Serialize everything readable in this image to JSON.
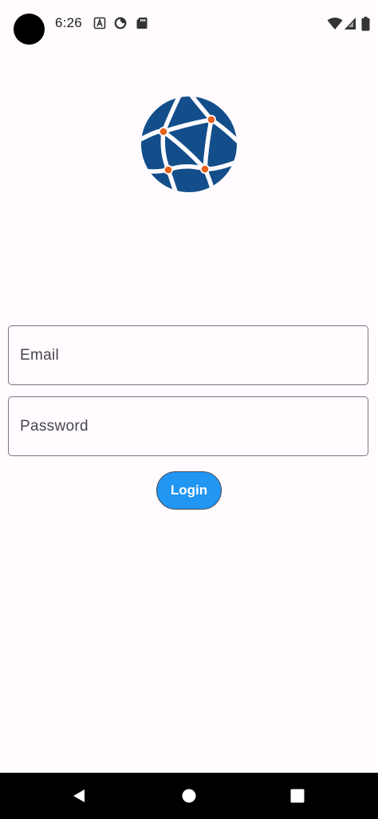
{
  "status_bar": {
    "time": "6:26",
    "left_icons": [
      "a-box-icon",
      "data-saver-icon",
      "sd-card-icon"
    ],
    "right_icons": [
      "wifi-icon",
      "cellular-signal-icon",
      "battery-icon"
    ]
  },
  "app": {
    "logo": "globe-network-logo",
    "colors": {
      "logo_blue": "#134e8a",
      "node_orange": "#e8631c",
      "button": "#2196f3"
    }
  },
  "form": {
    "email_placeholder": "Email",
    "password_placeholder": "Password",
    "login_label": "Login"
  },
  "nav_bar": {
    "buttons": [
      "back-icon",
      "home-icon",
      "recents-icon"
    ]
  }
}
